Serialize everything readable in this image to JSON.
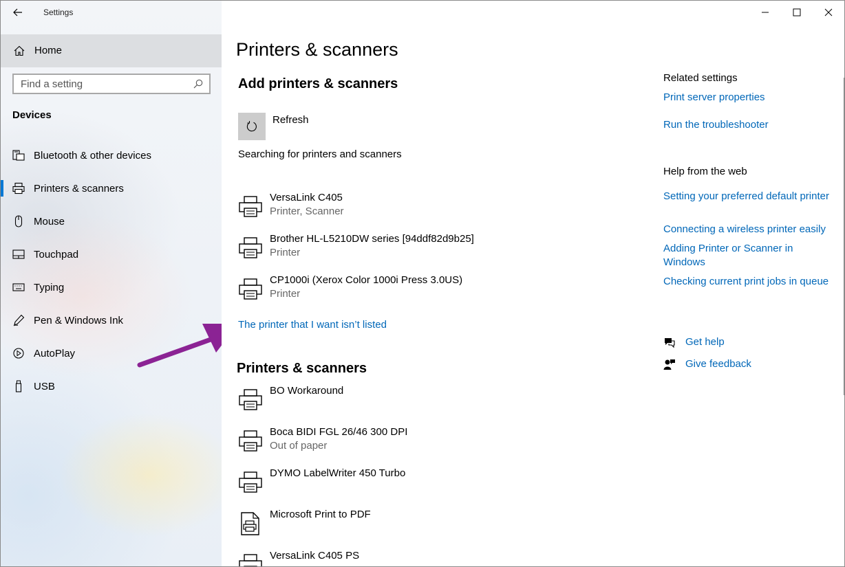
{
  "window": {
    "title": "Settings"
  },
  "sidebar": {
    "home_label": "Home",
    "search_placeholder": "Find a setting",
    "section_title": "Devices",
    "items": [
      {
        "label": "Bluetooth & other devices",
        "icon": "bluetooth-devices-icon",
        "active": false
      },
      {
        "label": "Printers & scanners",
        "icon": "printer-icon",
        "active": true
      },
      {
        "label": "Mouse",
        "icon": "mouse-icon",
        "active": false
      },
      {
        "label": "Touchpad",
        "icon": "touchpad-icon",
        "active": false
      },
      {
        "label": "Typing",
        "icon": "keyboard-icon",
        "active": false
      },
      {
        "label": "Pen & Windows Ink",
        "icon": "pen-icon",
        "active": false
      },
      {
        "label": "AutoPlay",
        "icon": "autoplay-icon",
        "active": false
      },
      {
        "label": "USB",
        "icon": "usb-icon",
        "active": false
      }
    ]
  },
  "main": {
    "title": "Printers & scanners",
    "add_section_title": "Add printers & scanners",
    "refresh_label": "Refresh",
    "searching_text": "Searching for printers and scanners",
    "discovered": [
      {
        "name": "VersaLink C405",
        "status": "Printer, Scanner"
      },
      {
        "name": "Brother HL-L5210DW series [94ddf82d9b25]",
        "status": "Printer"
      },
      {
        "name": "CP1000i (Xerox Color 1000i Press 3.0US)",
        "status": "Printer"
      }
    ],
    "not_listed_link": "The printer that I want isn’t listed",
    "installed_section_title": "Printers & scanners",
    "installed": [
      {
        "name": "BO Workaround",
        "status": "",
        "icon": "printer-icon"
      },
      {
        "name": "Boca BIDI FGL 26/46 300 DPI",
        "status": "Out of paper",
        "icon": "printer-icon"
      },
      {
        "name": "DYMO LabelWriter 450 Turbo",
        "status": "",
        "icon": "printer-icon"
      },
      {
        "name": "Microsoft Print to PDF",
        "status": "",
        "icon": "pdf-printer-icon"
      },
      {
        "name": "VersaLink C405 PS",
        "status": "",
        "icon": "printer-icon"
      }
    ]
  },
  "related": {
    "title": "Related settings",
    "links": [
      "Print server properties",
      "Run the troubleshooter"
    ]
  },
  "help_web": {
    "title": "Help from the web",
    "links": [
      "Setting your preferred default printer",
      "Connecting a wireless printer easily",
      "Adding Printer or Scanner in Windows",
      "Checking current print jobs in queue"
    ]
  },
  "support": {
    "get_help": "Get help",
    "give_feedback": "Give feedback"
  },
  "colors": {
    "accent": "#0078d4",
    "link": "#0067b8",
    "annotation_arrow": "#8b2394"
  }
}
